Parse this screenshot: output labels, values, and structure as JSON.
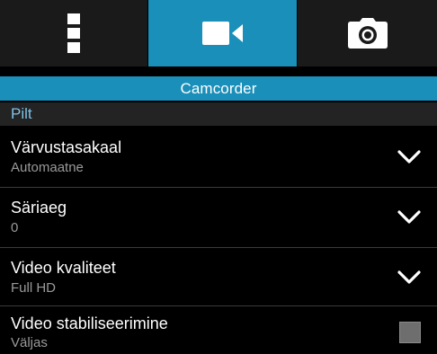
{
  "tabs": [
    {
      "icon": "menu-icon",
      "selected": false
    },
    {
      "icon": "videocam-icon",
      "selected": true
    },
    {
      "icon": "camera-icon",
      "selected": false
    }
  ],
  "header": {
    "title": "Camcorder"
  },
  "section": {
    "label": "Pilt"
  },
  "settings": [
    {
      "title": "Värvustasakaal",
      "value": "Automaatne",
      "control": "dropdown"
    },
    {
      "title": "Säriaeg",
      "value": "0",
      "control": "dropdown"
    },
    {
      "title": "Video kvaliteet",
      "value": "Full HD",
      "control": "dropdown"
    },
    {
      "title": "Video stabiliseerimine",
      "value": "Väljas",
      "control": "checkbox",
      "checked": false
    }
  ],
  "colors": {
    "accent": "#1a8fb9",
    "section_text": "#7ec2e8",
    "background": "#000000",
    "tab_background": "#1a1a1a",
    "subtitle_text": "#9a9a9a"
  }
}
